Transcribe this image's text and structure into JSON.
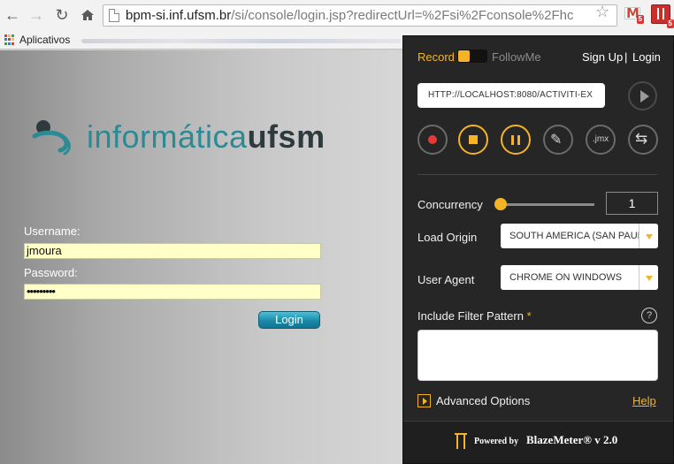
{
  "browser": {
    "url_host": "bpm-si.inf.ufsm.br",
    "url_path": "/si/console/login.jsp?redirectUrl=%2Fsi%2Fconsole%2Fhc",
    "icons": {
      "back": "arrow-left-icon",
      "forward": "arrow-right-icon",
      "reload": "reload-icon",
      "home": "home-icon",
      "bookmark": "star-icon"
    },
    "extensions": {
      "gmail_letter": "M",
      "gmail_badge": "5",
      "blazemeter_badge": "5"
    },
    "bookmarks_bar": {
      "apps_label": "Aplicativos"
    }
  },
  "page": {
    "logo": {
      "part1": "informática",
      "part2": "ufsm"
    },
    "username_label": "Username:",
    "username_value": "jmoura",
    "password_label": "Password:",
    "password_value": "•••••••••",
    "login_button": "Login"
  },
  "blazemeter": {
    "record_label": "Record",
    "followme_label": "FollowMe",
    "sign_up": "Sign Up",
    "separator": "|",
    "login": "Login",
    "url_value": "HTTP://LOCALHOST:8080/ACTIVITI-EX",
    "controls": [
      "record-icon",
      "stop-icon",
      "pause-icon",
      "edit-icon",
      "jmx-icon",
      "repeat-icon"
    ],
    "jmx_label": ".jmx",
    "concurrency_label": "Concurrency",
    "concurrency_value": "1",
    "load_origin_label": "Load Origin",
    "load_origin_value": "SOUTH AMERICA (SAN PAULO)",
    "user_agent_label": "User Agent",
    "user_agent_value": "CHROME ON WINDOWS",
    "filter_label": "Include Filter Pattern",
    "filter_required": "*",
    "help_question": "?",
    "advanced_options": "Advanced Options",
    "help_link": "Help",
    "footer_powered": "Powered by",
    "footer_brand": "BlazeMeter® v 2.0",
    "accent_color": "#f5b428"
  }
}
